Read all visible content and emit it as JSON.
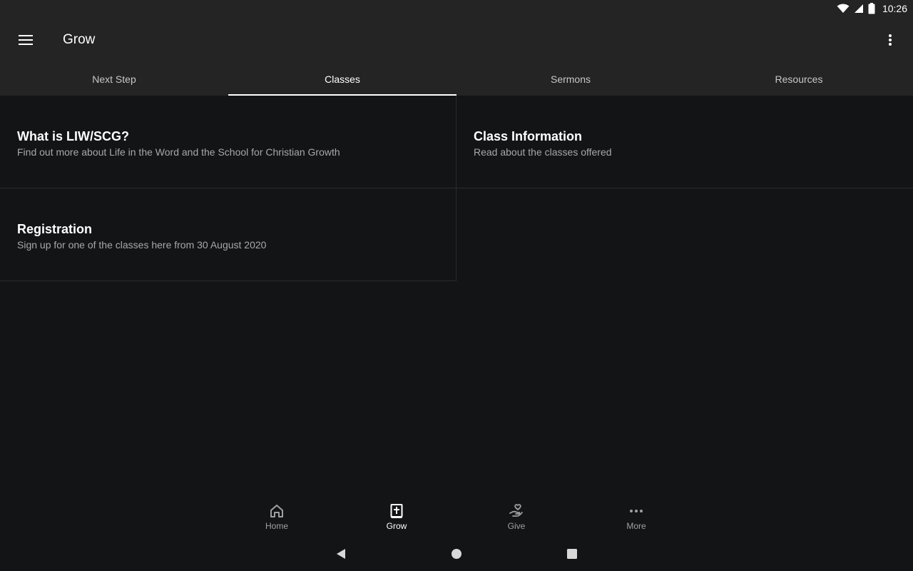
{
  "status_bar": {
    "time": "10:26",
    "icons": [
      "wifi-icon",
      "signal-icon",
      "battery-icon"
    ]
  },
  "app_bar": {
    "title": "Grow",
    "menu_icon": "hamburger-menu-icon",
    "overflow_icon": "more-vert-icon"
  },
  "tabs": [
    {
      "label": "Next Step",
      "active": false
    },
    {
      "label": "Classes",
      "active": true
    },
    {
      "label": "Sermons",
      "active": false
    },
    {
      "label": "Resources",
      "active": false
    }
  ],
  "cards": [
    {
      "title": "What is LIW/SCG?",
      "subtitle": "Find out more about Life in the Word and the School for Christian Growth"
    },
    {
      "title": "Class Information",
      "subtitle": "Read about the classes offered"
    },
    {
      "title": "Registration",
      "subtitle": "Sign up for one of the classes here from 30 August 2020"
    }
  ],
  "bottom_nav": [
    {
      "label": "Home",
      "icon": "home-icon",
      "active": false
    },
    {
      "label": "Grow",
      "icon": "bible-icon",
      "active": true
    },
    {
      "label": "Give",
      "icon": "give-hand-heart-icon",
      "active": false
    },
    {
      "label": "More",
      "icon": "more-horiz-icon",
      "active": false
    }
  ],
  "system_nav": [
    "back-icon",
    "home-circle-icon",
    "recents-icon"
  ],
  "colors": {
    "background": "#131416",
    "app_bar": "#242424",
    "divider": "#2a2b2e",
    "text_primary": "#ffffff",
    "text_secondary": "#a8a8a8"
  }
}
